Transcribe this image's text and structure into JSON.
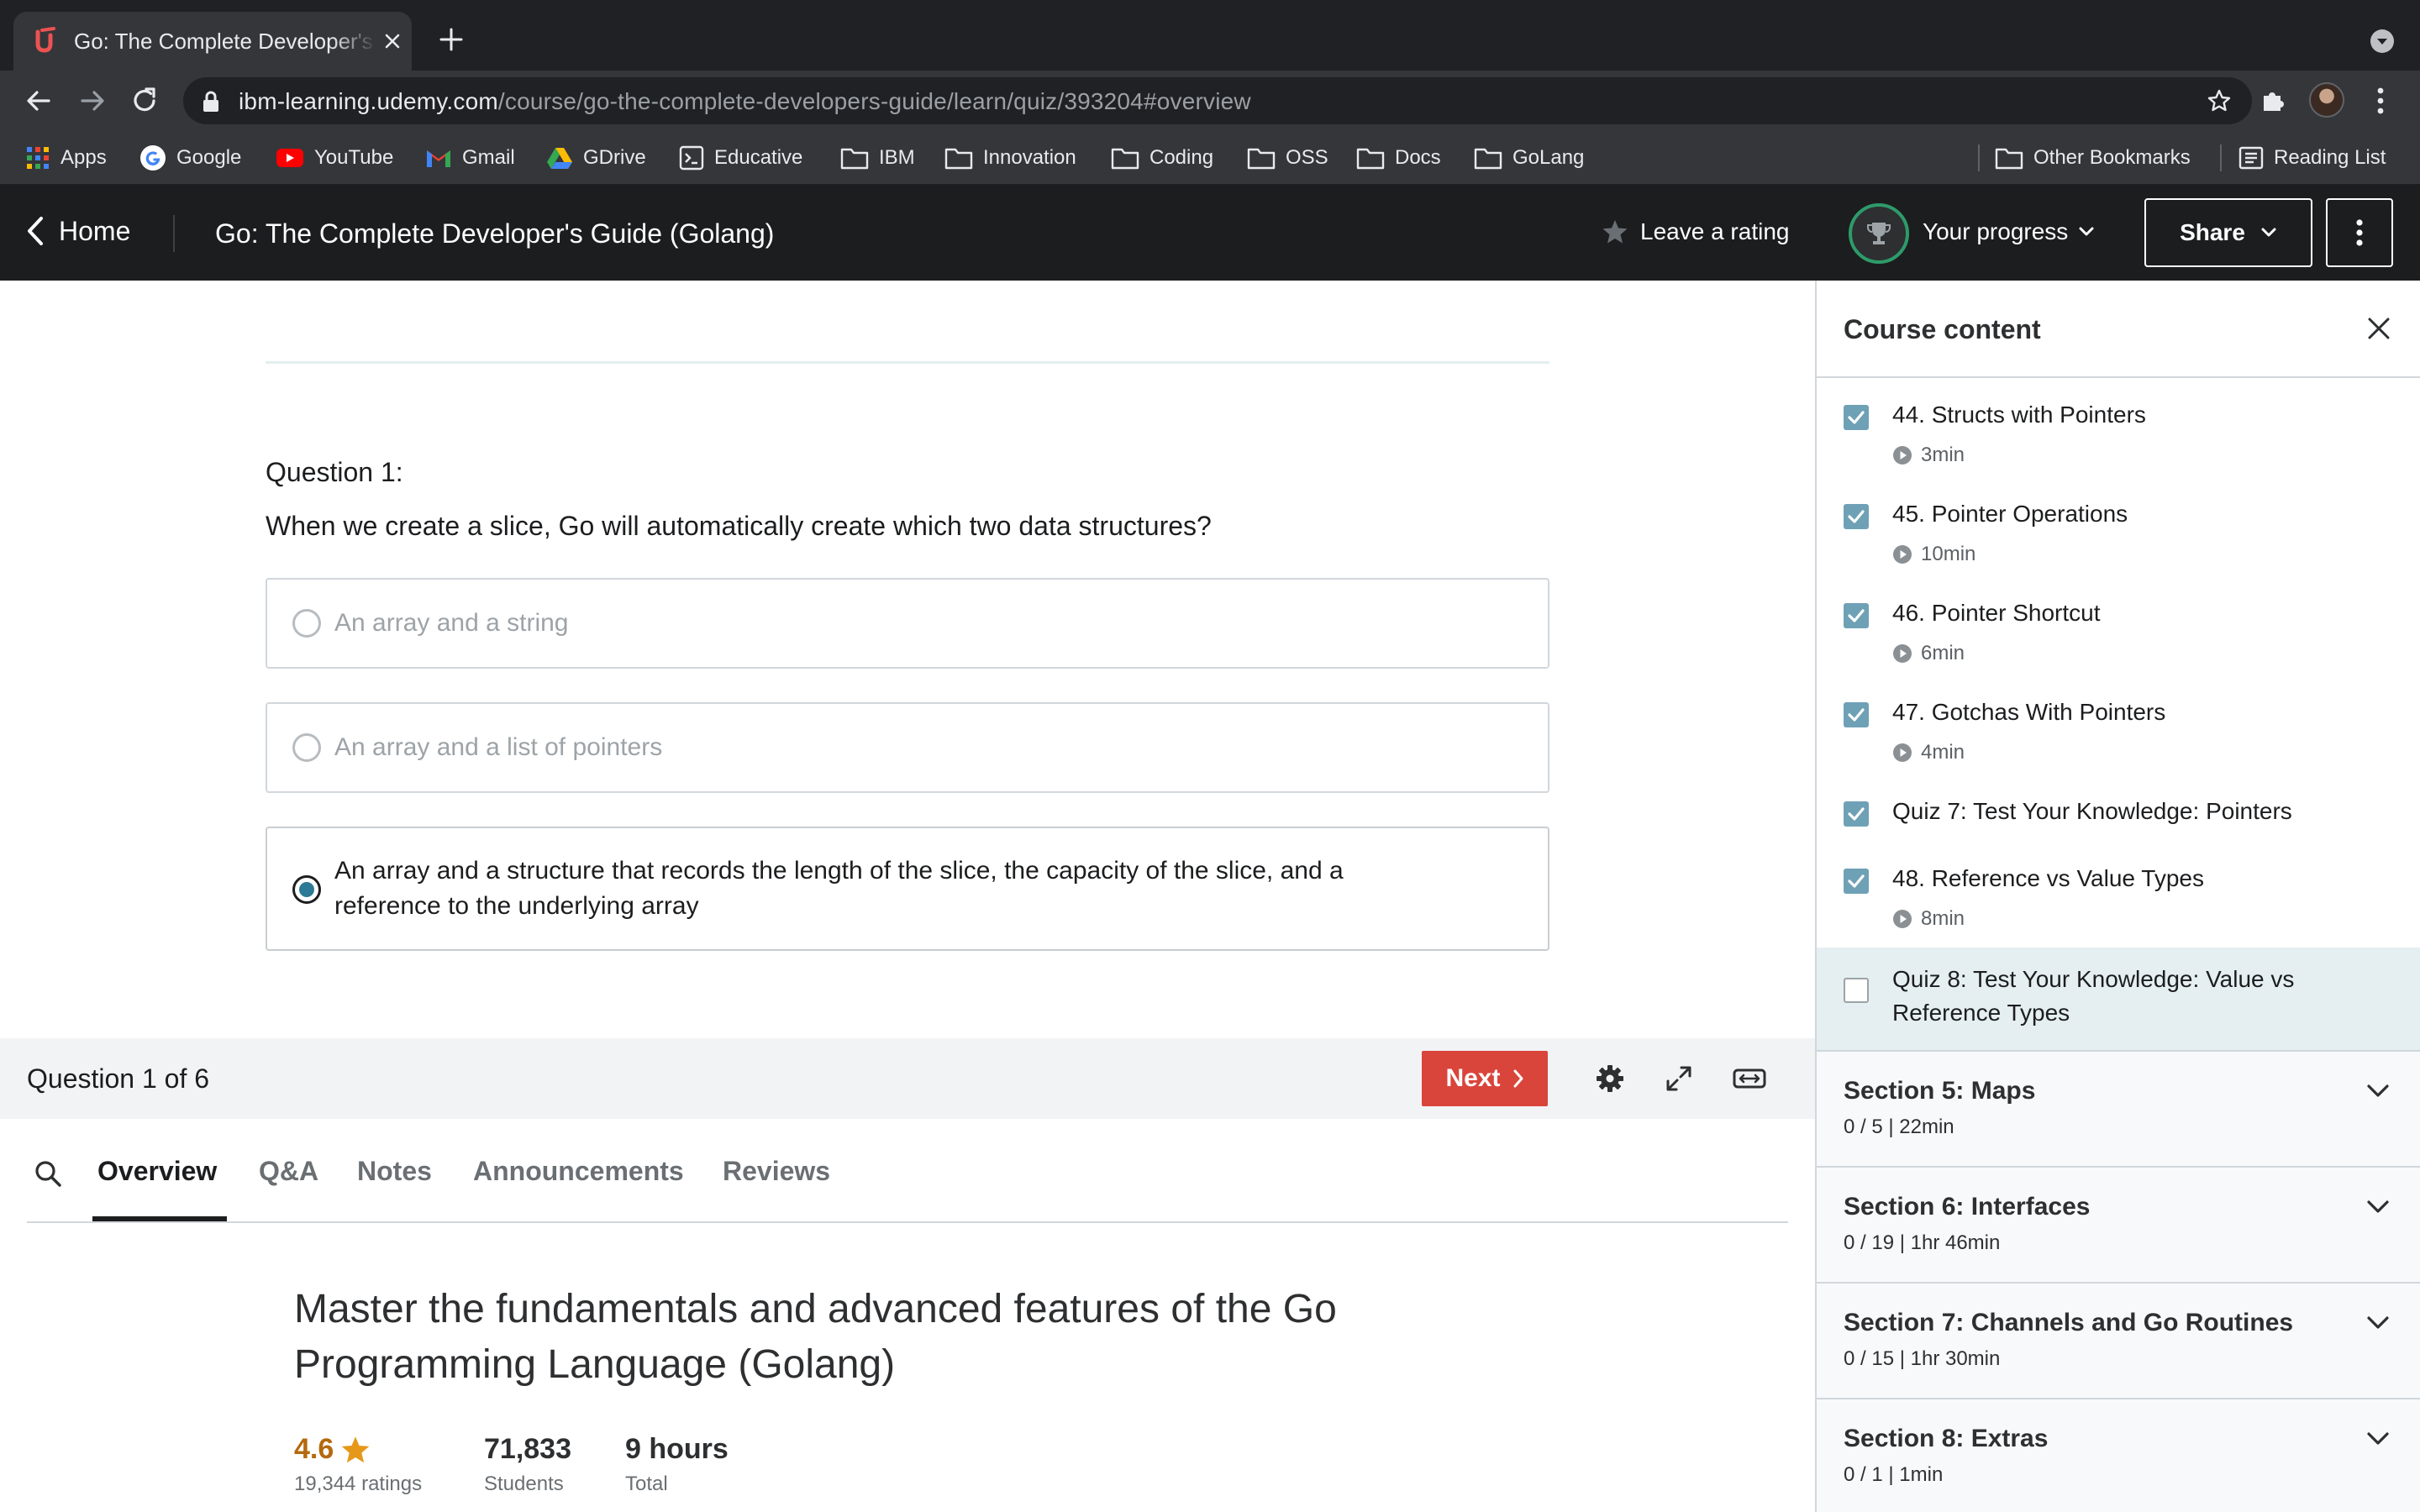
{
  "browser": {
    "tab_title": "Go: The Complete Developer's Guide (Golang)",
    "url_domain": "ibm-learning.udemy.com",
    "url_path": "/course/go-the-complete-developers-guide/learn/quiz/393204#overview",
    "bookmarks": [
      {
        "label": "Apps",
        "icon": "apps-grid-icon"
      },
      {
        "label": "Google",
        "icon": "google-icon"
      },
      {
        "label": "YouTube",
        "icon": "youtube-icon"
      },
      {
        "label": "Gmail",
        "icon": "gmail-icon"
      },
      {
        "label": "GDrive",
        "icon": "gdrive-icon"
      },
      {
        "label": "Educative",
        "icon": "educative-icon"
      },
      {
        "label": "IBM",
        "icon": "folder-icon"
      },
      {
        "label": "Innovation",
        "icon": "folder-icon"
      },
      {
        "label": "Coding",
        "icon": "folder-icon"
      },
      {
        "label": "OSS",
        "icon": "folder-icon"
      },
      {
        "label": "Docs",
        "icon": "folder-icon"
      },
      {
        "label": "GoLang",
        "icon": "folder-icon"
      }
    ],
    "other_bookmarks": "Other Bookmarks",
    "reading_list": "Reading List"
  },
  "header": {
    "home": "Home",
    "course_title": "Go: The Complete Developer's Guide (Golang)",
    "leave_rating": "Leave a rating",
    "your_progress": "Your progress",
    "share": "Share"
  },
  "quiz": {
    "question_label": "Question 1:",
    "question_text": "When we create a slice, Go will automatically create which two data structures?",
    "answers": [
      {
        "text": "An array and a string",
        "selected": false
      },
      {
        "text": "An array and a list of pointers",
        "selected": false
      },
      {
        "text": "An array and a structure that records the length of the slice, the capacity of the slice, and a reference to the underlying array",
        "selected": true
      }
    ],
    "counter": "Question 1 of 6",
    "next": "Next"
  },
  "tabs": {
    "items": [
      "Overview",
      "Q&A",
      "Notes",
      "Announcements",
      "Reviews"
    ],
    "active": "Overview"
  },
  "overview": {
    "headline": "Master the fundamentals and advanced features of the Go Programming Language (Golang)",
    "rating": "4.6",
    "ratings_count": "19,344 ratings",
    "students": "71,833",
    "students_label": "Students",
    "hours": "9 hours",
    "hours_label": "Total"
  },
  "sidebar": {
    "title": "Course content",
    "lectures": [
      {
        "title": "44. Structs with Pointers",
        "duration": "3min",
        "checked": true
      },
      {
        "title": "45. Pointer Operations",
        "duration": "10min",
        "checked": true
      },
      {
        "title": "46. Pointer Shortcut",
        "duration": "6min",
        "checked": true
      },
      {
        "title": "47. Gotchas With Pointers",
        "duration": "4min",
        "checked": true
      },
      {
        "title": "Quiz 7: Test Your Knowledge: Pointers",
        "duration": "",
        "checked": true
      },
      {
        "title": "48. Reference vs Value Types",
        "duration": "8min",
        "checked": true
      },
      {
        "title": "Quiz 8: Test Your Knowledge: Value vs Reference Types",
        "duration": "",
        "checked": false
      }
    ],
    "sections": [
      {
        "title": "Section 5: Maps",
        "meta": "0 / 5 | 22min"
      },
      {
        "title": "Section 6: Interfaces",
        "meta": "0 / 19 | 1hr 46min"
      },
      {
        "title": "Section 7: Channels and Go Routines",
        "meta": "0 / 15 | 1hr 30min"
      },
      {
        "title": "Section 8: Extras",
        "meta": "0 / 1 | 1min"
      }
    ]
  },
  "colors": {
    "udemy_dark": "#1c1d1f",
    "next_button": "#d9453b",
    "checkbox": "#6fa1b6",
    "radio_selected": "#2c7a95",
    "rating": "#b4690e",
    "current_lecture_bg": "#e5eff1"
  }
}
